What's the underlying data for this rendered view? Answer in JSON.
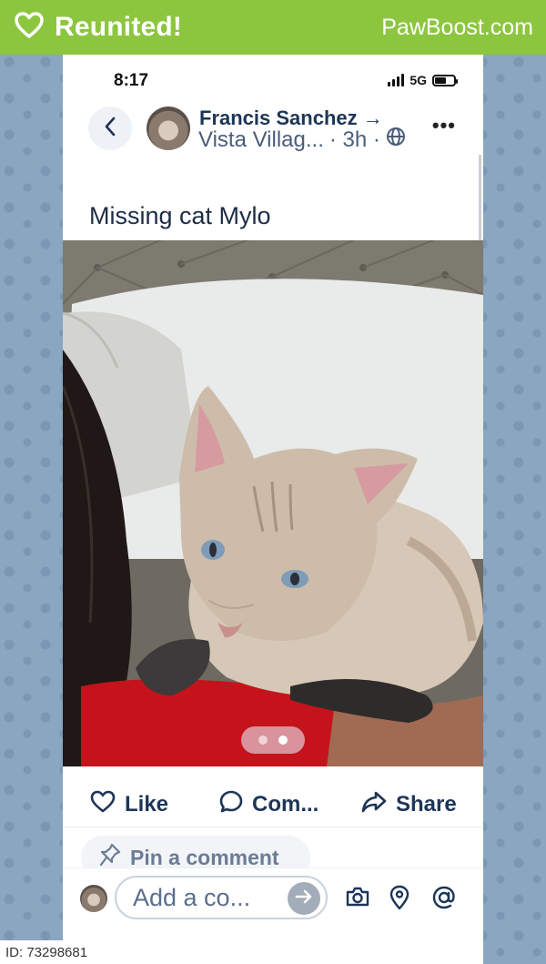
{
  "banner": {
    "title": "Reunited!",
    "brand": "PawBoost.com",
    "color": "#8cc63f"
  },
  "status_bar": {
    "time": "8:17",
    "network": "5G"
  },
  "post": {
    "author": "Francis Sanchez →",
    "location": "Vista Villag...",
    "age": "· 3h ·",
    "title": "Missing cat Mylo",
    "carousel": {
      "total": 2,
      "active": 2
    }
  },
  "actions": {
    "like": "Like",
    "comment": "Com...",
    "share": "Share"
  },
  "pin": {
    "label": "Pin a comment"
  },
  "compose": {
    "placeholder": "Add a co..."
  },
  "footer": {
    "id": "ID: 73298681"
  },
  "icons": [
    "heart-icon",
    "back-chevron-icon",
    "globe-icon",
    "more-icon",
    "comment-icon",
    "share-icon",
    "pin-icon",
    "send-arrow-icon",
    "camera-icon",
    "location-icon",
    "at-icon"
  ]
}
